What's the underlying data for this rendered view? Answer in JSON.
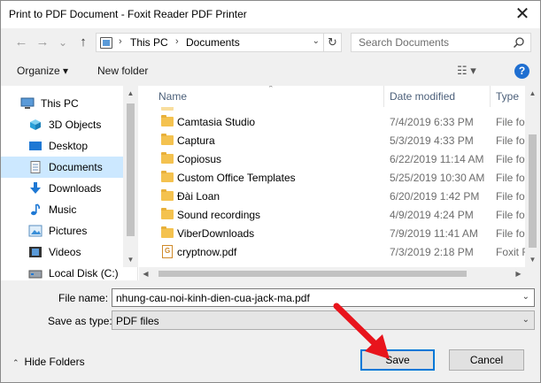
{
  "window": {
    "title": "Print to PDF Document - Foxit Reader PDF Printer",
    "close_glyph": "✕"
  },
  "nav": {
    "back": "←",
    "forward": "→",
    "recent": "⌄",
    "up": "↑"
  },
  "address": {
    "crumbs": [
      "This PC",
      "Documents"
    ],
    "separator": "›",
    "dropdown": "⌄",
    "refresh": "↻"
  },
  "search": {
    "placeholder": "Search Documents",
    "icon": "search-icon"
  },
  "toolbar": {
    "organize": "Organize ▾",
    "new_folder": "New folder",
    "view_icon": "☷ ▾",
    "help": "?"
  },
  "sidebar": {
    "items": [
      {
        "label": "This PC",
        "icon": "computer-icon"
      },
      {
        "label": "3D Objects",
        "icon": "3d-objects-icon"
      },
      {
        "label": "Desktop",
        "icon": "desktop-icon"
      },
      {
        "label": "Documents",
        "icon": "documents-icon",
        "selected": true
      },
      {
        "label": "Downloads",
        "icon": "downloads-icon"
      },
      {
        "label": "Music",
        "icon": "music-icon"
      },
      {
        "label": "Pictures",
        "icon": "pictures-icon"
      },
      {
        "label": "Videos",
        "icon": "videos-icon"
      },
      {
        "label": "Local Disk (C:)",
        "icon": "drive-icon"
      }
    ]
  },
  "files": {
    "columns": {
      "name": "Name",
      "date": "Date modified",
      "type": "Type"
    },
    "rows": [
      {
        "name": "Camtasia Studio",
        "date": "7/4/2019 6:33 PM",
        "type": "File fol",
        "kind": "folder"
      },
      {
        "name": "Captura",
        "date": "5/3/2019 4:33 PM",
        "type": "File fol",
        "kind": "folder"
      },
      {
        "name": "Copiosus",
        "date": "6/22/2019 11:14 AM",
        "type": "File fol",
        "kind": "folder"
      },
      {
        "name": "Custom Office Templates",
        "date": "5/25/2019 10:30 AM",
        "type": "File fol",
        "kind": "folder"
      },
      {
        "name": "Đài Loan",
        "date": "6/20/2019 1:42 PM",
        "type": "File fol",
        "kind": "folder"
      },
      {
        "name": "Sound recordings",
        "date": "4/9/2019 4:24 PM",
        "type": "File fol",
        "kind": "folder"
      },
      {
        "name": "ViberDownloads",
        "date": "7/9/2019 11:41 AM",
        "type": "File fol",
        "kind": "folder"
      },
      {
        "name": "cryptnow.pdf",
        "date": "7/3/2019 2:18 PM",
        "type": "Foxit R",
        "kind": "pdf"
      }
    ]
  },
  "form": {
    "file_name_label": "File name:",
    "file_name_value": "nhung-cau-noi-kinh-dien-cua-jack-ma.pdf",
    "save_type_label": "Save as type:",
    "save_type_value": "PDF files",
    "dropdown": "⌄"
  },
  "footer": {
    "hide_folders": "Hide Folders",
    "chevron": "⌃",
    "save": "Save",
    "cancel": "Cancel"
  },
  "colors": {
    "accent": "#0078d7",
    "selection": "#cce8ff",
    "annotation_arrow": "#e8141c"
  }
}
